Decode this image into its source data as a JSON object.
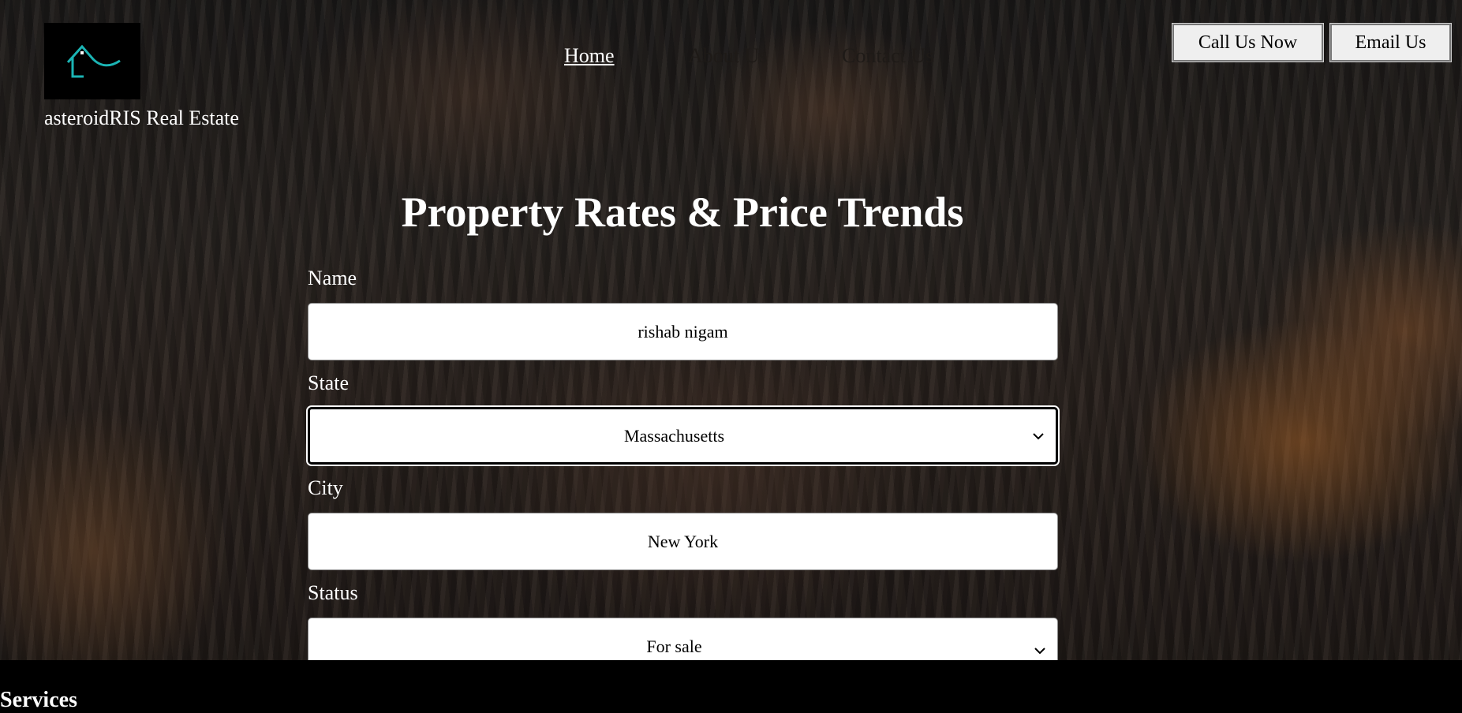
{
  "header": {
    "brand_name": "asteroidRIS Real Estate",
    "logo_icon": "house-icon",
    "logo_color": "#1bb5b5",
    "nav": [
      {
        "label": "Home",
        "active": true
      },
      {
        "label": "About Us",
        "active": false
      },
      {
        "label": "Contact Us",
        "active": false
      }
    ],
    "call_button": "Call Us Now",
    "email_button": "Email Us"
  },
  "form": {
    "title": "Property Rates & Price Trends",
    "name_label": "Name",
    "name_value": "rishab nigam",
    "state_label": "State",
    "state_value": "Massachusetts",
    "city_label": "City",
    "city_value": "New York",
    "status_label": "Status",
    "status_value": "For sale"
  },
  "services": {
    "title": "Services"
  }
}
